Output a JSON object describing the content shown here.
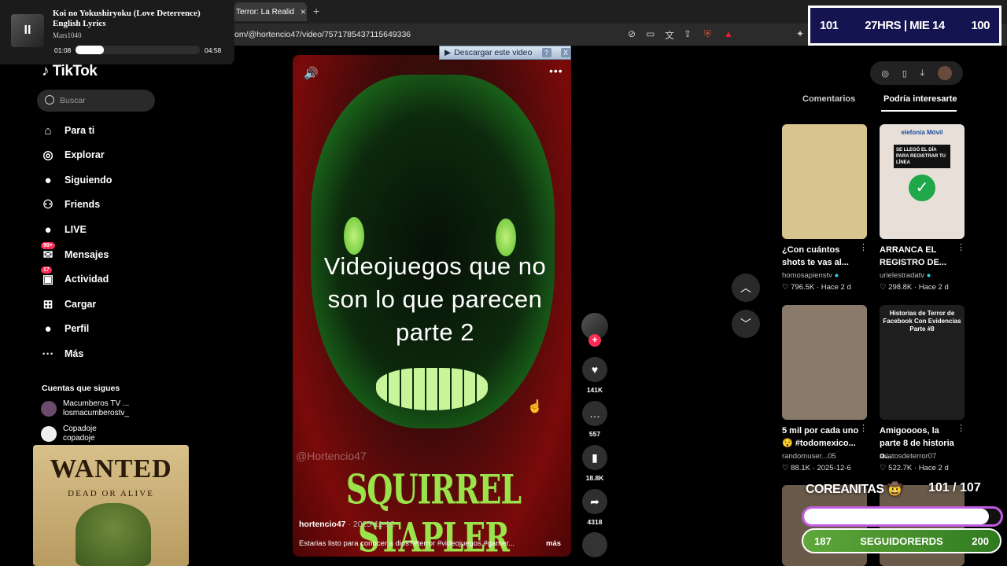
{
  "browser": {
    "tab_title": "Terror: La Realid",
    "tab_close": "×",
    "new_tab": "+",
    "url": "om/@hortencio47/video/7571785437115649336",
    "toolbar_icons": [
      "no-camera-icon",
      "cast-icon",
      "translate-icon",
      "share-icon",
      "shield-extension-icon",
      "warning-extension-icon"
    ]
  },
  "music_player": {
    "song": "Koi no Yokushiryoku (Love Deterrence) English Lyrics",
    "artist": "Mars1040",
    "current_time": "01:08",
    "total_time": "04:58",
    "progress": 0.23,
    "play_state_icon": "II"
  },
  "sidebar": {
    "logo": "TikTok",
    "search_placeholder": "Buscar",
    "items": [
      {
        "label": "Para ti",
        "icon": "⌂"
      },
      {
        "label": "Explorar",
        "icon": "◎"
      },
      {
        "label": "Siguiendo",
        "icon": "●"
      },
      {
        "label": "Friends",
        "icon": "⚇"
      },
      {
        "label": "LIVE",
        "icon": "●"
      },
      {
        "label": "Mensajes",
        "icon": "✉",
        "badge": "99+"
      },
      {
        "label": "Actividad",
        "icon": "▣",
        "badge": "17"
      },
      {
        "label": "Cargar",
        "icon": "⊞"
      },
      {
        "label": "Perfil",
        "icon": "●"
      },
      {
        "label": "Más",
        "icon": "···"
      }
    ],
    "following_title": "Cuentas que sigues",
    "following": [
      {
        "name": "Macumberos TV ...",
        "handle": "losmacumberostv_"
      },
      {
        "name": "Copadoje",
        "handle": "copadoje"
      }
    ]
  },
  "wanted_poster": {
    "title": "WANTED",
    "subtitle": "DEAD OR ALIVE"
  },
  "video": {
    "download_bar": "Descargar este video",
    "download_help": "?",
    "download_close": "X",
    "caption": "Videojuegos que no son lo que parecen parte 2",
    "watermark": "@Hortencio47",
    "brand_text": "SQUIRREL STAPLER",
    "author": "hortencio47",
    "date": "· 2025-11-12",
    "description": "Estarias listo para conocer a dios?#terror #videojuegos #gamer...",
    "more": "más",
    "more_dots": "•••",
    "volume_icon": "🔊"
  },
  "actions": {
    "follow_plus": "+",
    "likes": "141K",
    "comments": "557",
    "saves": "18.8K",
    "shares": "4318"
  },
  "right_panel": {
    "tabs": [
      "Comentarios",
      "Podría interesarte"
    ],
    "active_tab": 1,
    "cards": [
      {
        "title": "¿Con cuántos shots te vas al...",
        "author": "homosapienstv",
        "verified": true,
        "likes": "796.5K",
        "date": "Hace 2 d",
        "color": "#d8c48e"
      },
      {
        "title": "ARRANCA EL REGISTRO DE...",
        "author": "urielestradatv",
        "verified": true,
        "likes": "298.8K",
        "date": "Hace 2 d",
        "color": "#e8e0d8",
        "img_text": "elefonía Móvil",
        "img_sub": "SE LLEGÓ EL DÍA PARA REGISTRAR TU LÍNEA"
      },
      {
        "title": "5 mil por cada uno 😯 #todomexico...",
        "author": "randomuser...05",
        "verified": false,
        "likes": "88.1K",
        "date": "2025-12-6",
        "color": "#8a7a6a"
      },
      {
        "title": "Amigoooos, la parte 8 de historia o...",
        "author": "relatosdeterror07",
        "verified": false,
        "likes": "522.7K",
        "date": "Hace 2 d",
        "color": "#1e1e1e",
        "img_text": "Historias de Terror de Facebook Con Evidencias Parte #8"
      }
    ]
  },
  "overlays": {
    "counter_left": "101",
    "counter_mid": "27HRS | MIE 14",
    "counter_right": "100",
    "goal_title": "COREANITAS 🤠",
    "goal_count": "101  /  107",
    "goal_progress": 0.94,
    "followers_left": "187",
    "followers_label": "SEGUIDORERDS",
    "followers_right": "200"
  }
}
